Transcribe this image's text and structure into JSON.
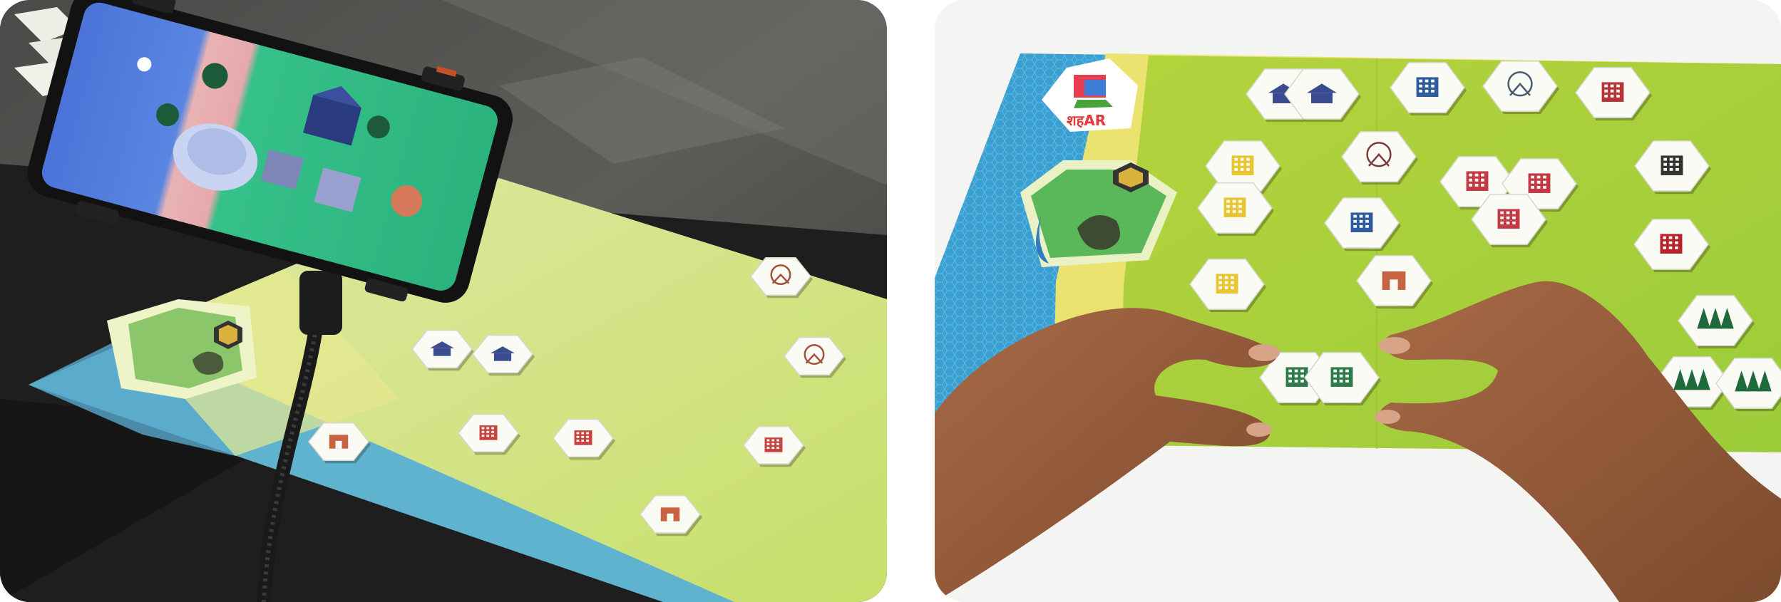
{
  "board_logo_text": "शहAR",
  "left_photo": {
    "board_tiles": [
      {
        "kind": "windmill-tile"
      },
      {
        "kind": "observatory-tile"
      },
      {
        "kind": "pagoda-tile"
      },
      {
        "kind": "pagoda-tile"
      },
      {
        "kind": "apartment-tile"
      },
      {
        "kind": "apartment-tile"
      },
      {
        "kind": "apartment-tile"
      },
      {
        "kind": "gate-tile"
      },
      {
        "kind": "gate-tile"
      }
    ]
  },
  "right_photo": {
    "board_tiles": [
      {
        "kind": "pagoda-tile"
      },
      {
        "kind": "pagoda-tile"
      },
      {
        "kind": "blue-building-tile"
      },
      {
        "kind": "satellite-tile"
      },
      {
        "kind": "red-tower-tile"
      },
      {
        "kind": "yellow-house-tile"
      },
      {
        "kind": "ferris-wheel-tile"
      },
      {
        "kind": "red-apartment-tile"
      },
      {
        "kind": "red-apartment-tile"
      },
      {
        "kind": "stadium-tile"
      },
      {
        "kind": "yellow-house-tile"
      },
      {
        "kind": "blue-building-tile"
      },
      {
        "kind": "red-apartment-tile"
      },
      {
        "kind": "barn-tile"
      },
      {
        "kind": "yellow-house-tile"
      },
      {
        "kind": "gate-tile"
      },
      {
        "kind": "forest-tile"
      },
      {
        "kind": "green-shop-tile"
      },
      {
        "kind": "green-shop-tile"
      },
      {
        "kind": "forest-tile"
      },
      {
        "kind": "forest-tile"
      }
    ]
  }
}
